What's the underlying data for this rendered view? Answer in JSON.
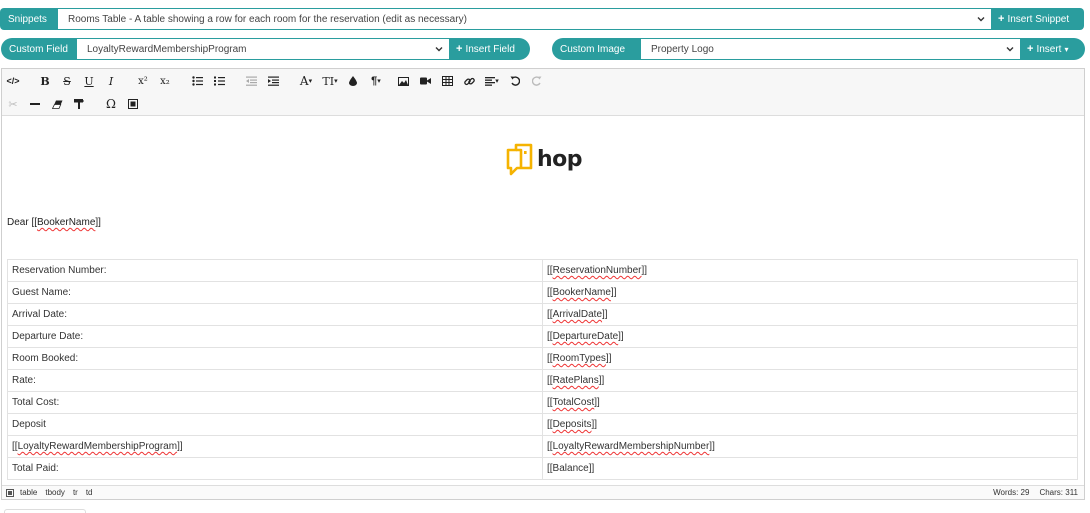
{
  "snippets": {
    "label": "Snippets",
    "selected": "Rooms Table - A table showing a row for each room for the reservation (edit as necessary)",
    "button": "Insert Snippet",
    "button_icon": "plus-icon"
  },
  "custom_field": {
    "label": "Custom Field",
    "selected": "LoyaltyRewardMembershipProgram",
    "button": "Insert Field"
  },
  "custom_image": {
    "label": "Custom Image",
    "selected": "Property Logo",
    "button": "Insert",
    "button_caret": "▾"
  },
  "toolbar": {
    "row1": [
      "code-view-icon",
      "bold-icon",
      "strikethrough-icon",
      "underline-icon",
      "italic-icon",
      "superscript-icon",
      "subscript-icon",
      "bullet-list-icon",
      "numbered-list-icon",
      "outdent-icon",
      "indent-icon",
      "font-color-icon",
      "font-size-icon",
      "text-color-drop-icon",
      "paragraph-icon",
      "image-icon",
      "video-icon",
      "table-icon",
      "link-icon",
      "align-icon",
      "undo-icon",
      "redo-icon"
    ],
    "row2": [
      "cut-icon",
      "horizontal-rule-icon",
      "clear-format-icon",
      "format-painter-icon",
      "special-char-icon",
      "select-all-icon"
    ]
  },
  "logo": {
    "text": "hop",
    "color": "#f5b301"
  },
  "greeting": {
    "prefix": "Dear [[",
    "field": "BookerName",
    "suffix": "]]"
  },
  "table": {
    "rows": [
      {
        "label": "Reservation Number:",
        "value_field": "ReservationNumber"
      },
      {
        "label": "Guest Name:",
        "value_field": "BookerName"
      },
      {
        "label": "Arrival Date:",
        "value_field": "ArrivalDate"
      },
      {
        "label": "Departure Date:",
        "value_field": "DepartureDate"
      },
      {
        "label": "Room Booked:",
        "value_field": "RoomTypes"
      },
      {
        "label": "Rate:",
        "value_field": "RatePlans"
      },
      {
        "label": "Total Cost:",
        "value_field": "TotalCost"
      },
      {
        "label": "Deposit",
        "value_field": "Deposits"
      },
      {
        "label_field": "LoyaltyRewardMembershipProgram",
        "value_field": "LoyaltyRewardMembershipNumber"
      },
      {
        "label": "Total Paid:",
        "value_plain": "[[Balance]]"
      }
    ]
  },
  "statusbar": {
    "path": [
      "table",
      "tbody",
      "tr",
      "td"
    ],
    "words": "Words: 29",
    "chars": "Chars: 311"
  },
  "colors": {
    "accent": "#2a9d9e"
  }
}
